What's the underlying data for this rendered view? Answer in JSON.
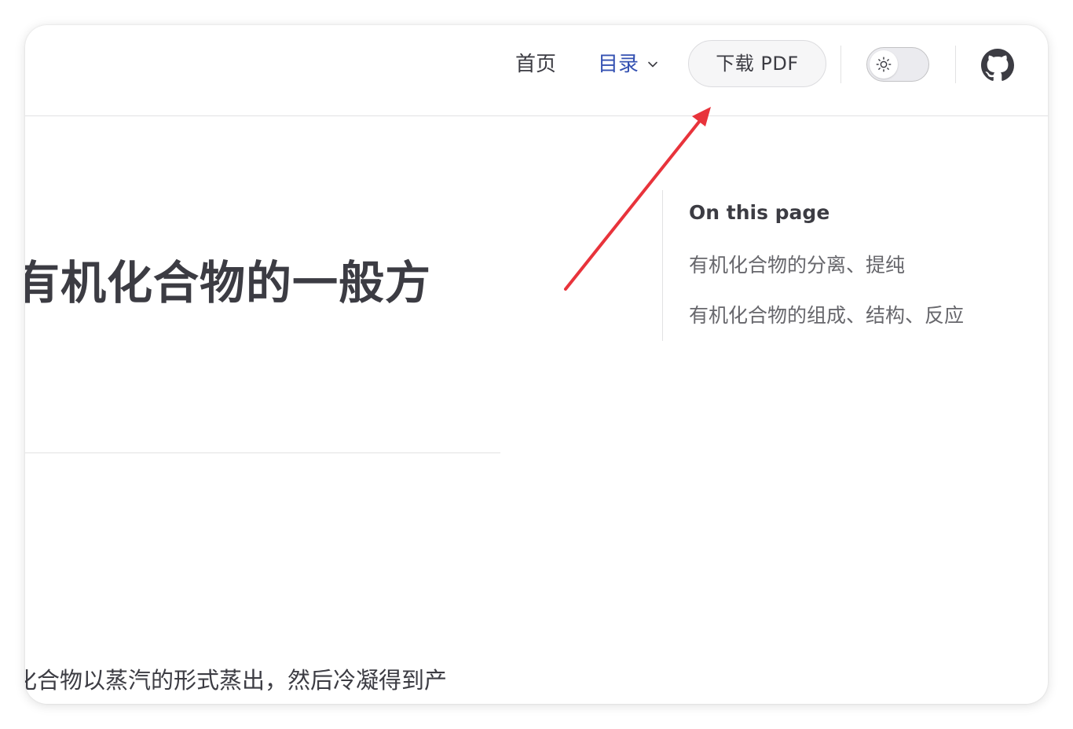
{
  "navbar": {
    "home_label": "首页",
    "catalog_label": "目录",
    "pdf_button_label": "下载 PDF"
  },
  "content": {
    "title_fragment": "有机化合物的一般方",
    "paragraph_fragment": "化合物以蒸汽的形式蒸出，然后冷凝得到产"
  },
  "toc": {
    "title": "On this page",
    "links": [
      "有机化合物的分离、提纯",
      "有机化合物的组成、结构、反应"
    ]
  },
  "colors": {
    "accent": "#3451b2",
    "text": "#3c3c43",
    "muted": "#67676c",
    "annotation_arrow": "#e8333b"
  },
  "icons": {
    "catalog_chevron": "chevron-down-icon",
    "theme": "sun-icon",
    "repo": "github-icon"
  }
}
